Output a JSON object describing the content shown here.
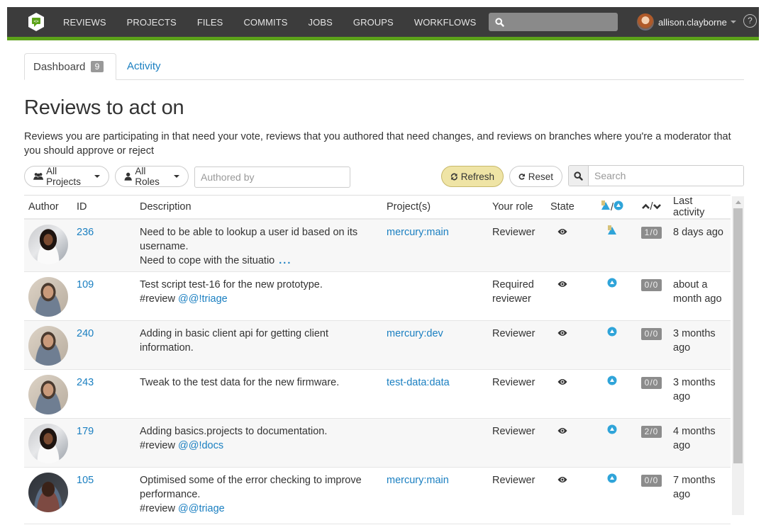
{
  "nav": {
    "items": [
      "REVIEWS",
      "PROJECTS",
      "FILES",
      "COMMITS",
      "JOBS",
      "GROUPS",
      "WORKFLOWS"
    ],
    "search_placeholder": "",
    "username": "allison.clayborne",
    "help": "?"
  },
  "tabs": {
    "dashboard": "Dashboard",
    "dashboard_count": "9",
    "activity": "Activity"
  },
  "page": {
    "title": "Reviews to act on",
    "description": "Reviews you are participating in that need your vote, reviews that you authored that need changes, and reviews on branches where you're a moderator that you should approve or reject"
  },
  "filters": {
    "projects": "All Projects",
    "roles": "All Roles",
    "authored_placeholder": "Authored by",
    "refresh": "Refresh",
    "reset": "Reset",
    "search_placeholder": "Search"
  },
  "table": {
    "headers": {
      "author": "Author",
      "id": "ID",
      "description": "Description",
      "projects": "Project(s)",
      "role": "Your role",
      "state": "State",
      "tests": "/",
      "votes": "/",
      "last_activity": "Last activity"
    },
    "rows": [
      {
        "avatar": "woman",
        "id": "236",
        "desc_lines": [
          "Need to be able to lookup a user id based on its username.",
          "Need to cope with the situatio"
        ],
        "truncated": "...",
        "desc_link": "",
        "desc_tag": "",
        "project": "mercury:main",
        "role": "Reviewer",
        "state_icon": "eye-icon",
        "test_icon": "test-pending-icon",
        "votes": "1/0",
        "last_activity": "8 days ago"
      },
      {
        "avatar": "man",
        "id": "109",
        "desc_lines": [
          "Test script test-16 for the new prototype."
        ],
        "truncated": "",
        "desc_tag": "#review",
        "desc_link": "@@!triage",
        "project": "",
        "role": "Required reviewer",
        "state_icon": "eye-icon",
        "test_icon": "test-queued-icon",
        "votes": "0/0",
        "last_activity": "about a month ago"
      },
      {
        "avatar": "man",
        "id": "240",
        "desc_lines": [
          "Adding in basic client api for getting client information."
        ],
        "truncated": "",
        "desc_tag": "",
        "desc_link": "",
        "project": "mercury:dev",
        "role": "Reviewer",
        "state_icon": "eye-icon",
        "test_icon": "test-queued-icon",
        "votes": "0/0",
        "last_activity": "3 months ago"
      },
      {
        "avatar": "man",
        "id": "243",
        "desc_lines": [
          "Tweak to the test data for the new firmware."
        ],
        "truncated": "",
        "desc_tag": "",
        "desc_link": "",
        "project": "test-data:data",
        "role": "Reviewer",
        "state_icon": "eye-icon",
        "test_icon": "test-queued-icon",
        "votes": "0/0",
        "last_activity": "3 months ago"
      },
      {
        "avatar": "woman",
        "id": "179",
        "desc_lines": [
          "Adding basics.projects to documentation."
        ],
        "truncated": "",
        "desc_tag": "#review",
        "desc_link": "@@!docs",
        "project": "",
        "role": "Reviewer",
        "state_icon": "eye-icon",
        "test_icon": "test-queued-icon",
        "votes": "2/0",
        "last_activity": "4 months ago"
      },
      {
        "avatar": "dark",
        "id": "105",
        "desc_lines": [
          "Optimised some of the error checking to improve performance."
        ],
        "truncated": "",
        "desc_tag": "#review",
        "desc_link": "@@triage",
        "project": "mercury:main",
        "role": "Reviewer",
        "state_icon": "eye-icon",
        "test_icon": "test-queued-icon",
        "votes": "0/0",
        "last_activity": "7 months ago"
      }
    ]
  },
  "colors": {
    "nav_bg": "#3c3c3c",
    "accent_green": "#5ca21a",
    "link": "#1a7fc1",
    "refresh_bg": "#efe4a5",
    "test_blue": "#2fa4d9",
    "badge_gray": "#8c8c8c"
  }
}
